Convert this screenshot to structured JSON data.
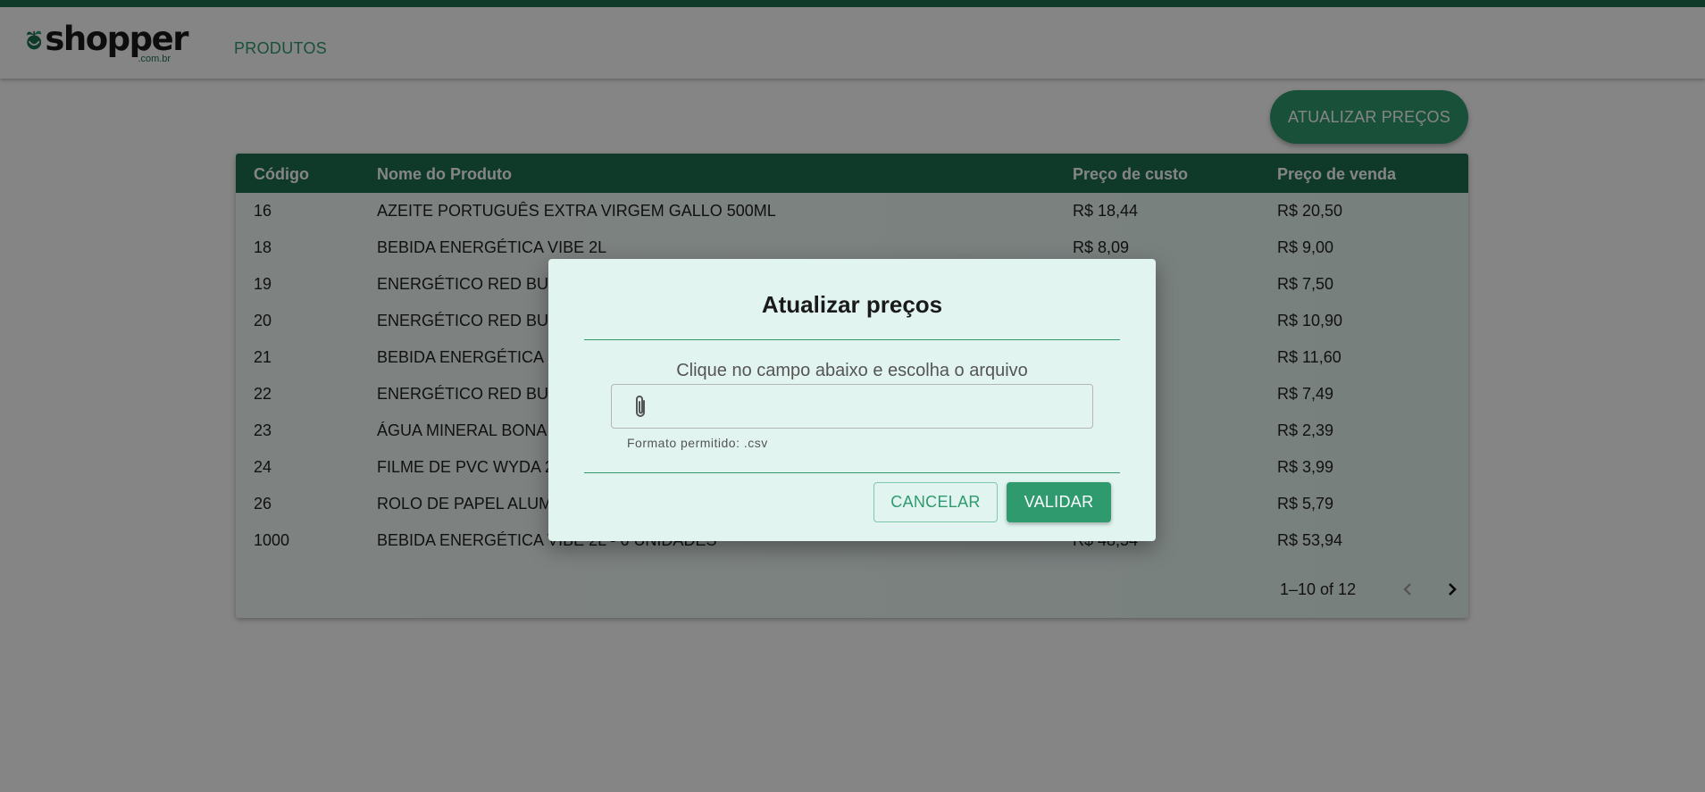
{
  "brand": {
    "logo_word": "shopper",
    "logo_sub": ".com.br"
  },
  "nav": {
    "products": "PRODUTOS"
  },
  "actions": {
    "update_prices": "ATUALIZAR PREÇOS"
  },
  "table": {
    "headers": [
      "Código",
      "Nome do Produto",
      "Preço de custo",
      "Preço de venda"
    ],
    "rows": [
      [
        "16",
        "AZEITE PORTUGUÊS EXTRA VIRGEM GALLO 500ML",
        "R$ 18,44",
        "R$ 20,50"
      ],
      [
        "18",
        "BEBIDA ENERGÉTICA VIBE 2L",
        "R$ 8,09",
        "R$ 9,00"
      ],
      [
        "19",
        "ENERGÉTICO RED BU",
        "",
        "R$ 7,50"
      ],
      [
        "20",
        "ENERGÉTICO RED BU",
        "",
        "R$ 10,90"
      ],
      [
        "21",
        "BEBIDA ENERGÉTICA",
        "",
        "R$ 11,60"
      ],
      [
        "22",
        "ENERGÉTICO RED BU",
        "",
        "R$ 7,49"
      ],
      [
        "23",
        "ÁGUA MINERAL BONA",
        "",
        "R$ 2,39"
      ],
      [
        "24",
        "FILME DE PVC WYDA 2",
        "",
        "R$ 3,99"
      ],
      [
        "26",
        "ROLO DE PAPEL ALUM",
        "",
        "R$ 5,79"
      ],
      [
        "1000",
        "BEBIDA ENERGÉTICA VIBE 2L - 6 UNIDADES",
        "R$ 48,54",
        "R$ 53,94"
      ]
    ],
    "pagination": "1–10 of 12"
  },
  "modal": {
    "title": "Atualizar preços",
    "instruction": "Clique no campo abaixo e escolha o arquivo",
    "helper": "Formato permitido: .csv",
    "cancel": "CANCELAR",
    "validate": "VALIDAR"
  },
  "colors": {
    "primary": "#2e9a6e",
    "header": "#1e6f52",
    "modal_bg": "#e1f4ef"
  }
}
